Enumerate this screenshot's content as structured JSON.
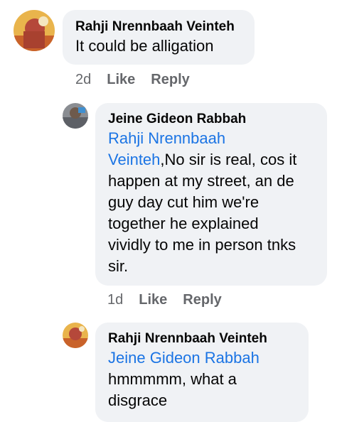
{
  "comments": [
    {
      "author": "Rahji Nrennbaah Veinteh",
      "text": "It could be alligation",
      "time": "2d",
      "like_label": "Like",
      "reply_label": "Reply"
    },
    {
      "author": "Jeine Gideon Rabbah",
      "mention_line1": "Rahji Nrennbaah",
      "mention_line2": "Veinteh",
      "text_line1": ",No sir is real, cos it",
      "text_line2": "happen at my street, an de",
      "text_line3": "guy day cut him we're",
      "text_line4": "together he explained",
      "text_line5": "vividly to me in person tnks",
      "text_line6": "sir.",
      "time": "1d",
      "like_label": "Like",
      "reply_label": "Reply"
    },
    {
      "author": "Rahji Nrennbaah Veinteh",
      "mention": "Jeine Gideon Rabbah",
      "text_line1": "hmmmmm, what a",
      "text_line2": "disgrace"
    }
  ]
}
